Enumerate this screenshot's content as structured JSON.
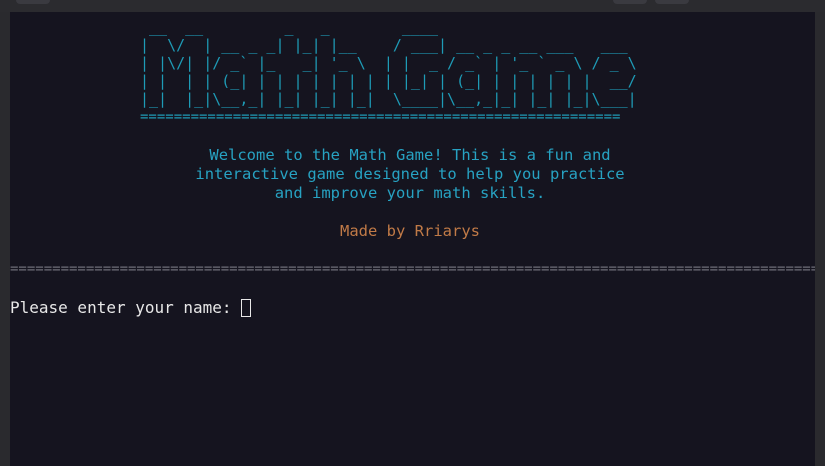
{
  "banner": {
    "ascii_title": " __  __         _   _        ____\n|  \\/  | __ _ _| |_| |__    / ___| __ _ _ __ ___   ___\n| |\\/| |/ _` |_   _| '_ \\  | |  _ / _` | '_ ` _ \\ / _ \\\n| |  | | (_| | | | | | | | | |_| | (_| | | | | | |  __/\n|_|  |_|\\__,_| |_| |_| |_|  \\____|\\__,_|_| |_| |_|\\___|",
    "title_rule": "=========================================================",
    "title_color": "#1e9bb6"
  },
  "welcome": {
    "line1": "Welcome to the Math Game! This is a fun and",
    "line2": "interactive game designed to help you practice",
    "line3": "and improve your math skills.",
    "color": "#27a2c2"
  },
  "credit": {
    "text": "Made by Rriarys",
    "color": "#c07a47"
  },
  "divider": {
    "text": "================================================================================================"
  },
  "prompt": {
    "text": "Please enter your name:"
  }
}
